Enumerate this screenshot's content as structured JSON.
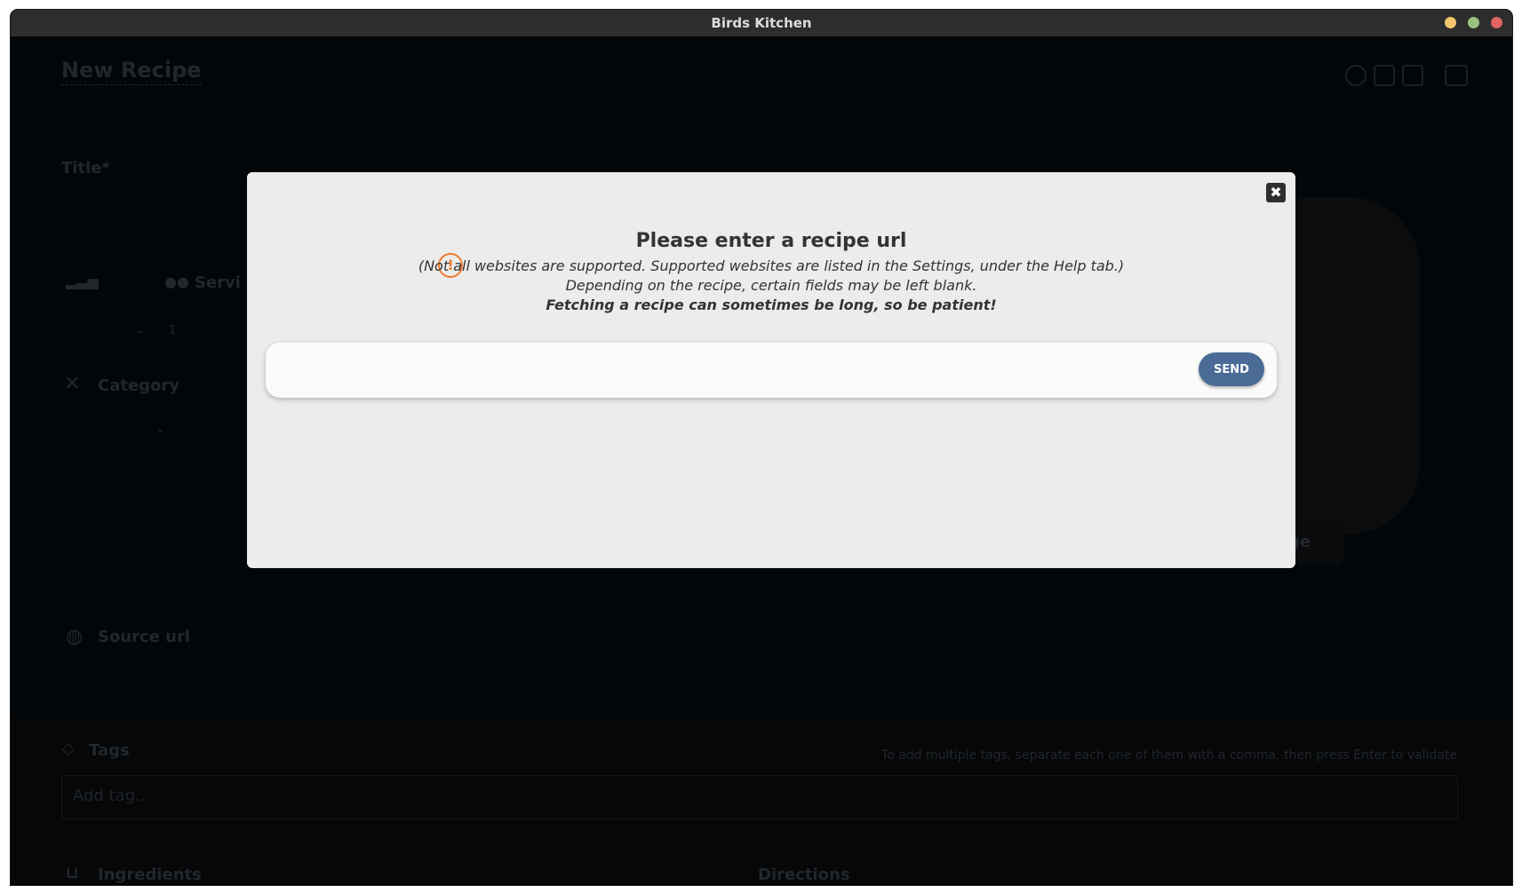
{
  "window": {
    "title": "Birds Kitchen"
  },
  "background": {
    "page_title": "New Recipe",
    "title_label": "Title*",
    "servings_label": "Servi",
    "servings_value": "1",
    "category_label": "Category",
    "source_url_label": "Source url",
    "tags_label": "Tags",
    "tags_help": "To add multiple tags, separate each one of them with a comma, then press Enter to validate",
    "tags_placeholder": "Add tag..",
    "ingredients_label": "Ingredients",
    "directions_label": "Directions",
    "image_button_label": "ge"
  },
  "modal": {
    "title": "Please enter a recipe url",
    "note_line1": "(Not all websites are supported. Supported websites are listed in the Settings, under the Help tab.)",
    "note_line2": "Depending on the recipe, certain fields may be left blank.",
    "note_line3": "Fetching a recipe can sometimes be long, so be patient!",
    "warning_symbol": "!",
    "close_symbol": "✖",
    "url_value": "",
    "send_label": "SEND"
  },
  "colors": {
    "send_button": "#4a6b96",
    "warning": "#ee7a2e",
    "modal_background": "#ececea",
    "overlay_background": "#030609"
  }
}
